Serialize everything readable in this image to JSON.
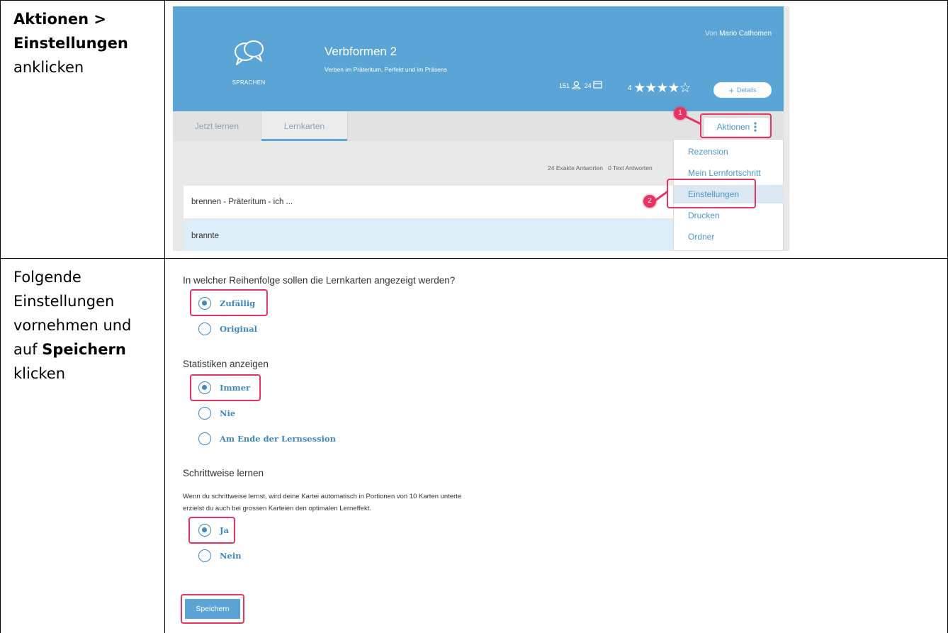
{
  "steps": [
    {
      "instruction": {
        "line1_bold": "Aktionen >",
        "line2_bold": "Einstellungen",
        "line3": "anklicken"
      }
    },
    {
      "instruction": {
        "line1": "Folgende",
        "line2": "Einstellungen",
        "line3": "vornehmen und",
        "line4_prefix": "auf ",
        "line4_bold": "Speichern",
        "line5": "klicken"
      }
    }
  ],
  "card_header": {
    "author_prefix": "Von",
    "author_name": "Mario Cathomen",
    "category": "SPRACHEN",
    "title": "Verbformen 2",
    "description": "Verben im Präteritum, Perfekt und im Präsens",
    "learners_count": "151",
    "cards_count": "24",
    "rating_count": "4",
    "stars": "★★★★☆",
    "details_label": "Details",
    "colors": {
      "header_bg": "#5ba5d6",
      "accent": "#4c95c9",
      "highlight": "#e53462"
    }
  },
  "tabs": [
    {
      "label": "Jetzt lernen"
    },
    {
      "label": "Lernkarten"
    }
  ],
  "actions_button": {
    "label": "Aktionen"
  },
  "answer_counts": {
    "exact": "24 Exakte Antworten",
    "text": "0 Text Antworten"
  },
  "card_rows": {
    "question": "brennen - Präteritum - ich ...",
    "answer": "brannte"
  },
  "actions_menu": [
    {
      "label": "Rezension"
    },
    {
      "label": "Mein Lernfortschritt"
    },
    {
      "label": "Einstellungen"
    },
    {
      "label": "Drucken"
    },
    {
      "label": "Ordner"
    }
  ],
  "callouts": [
    "1",
    "2"
  ],
  "settings": {
    "order": {
      "question": "In welcher Reihenfolge sollen die Lernkarten angezeigt werden?",
      "options": [
        "Zufällig",
        "Original"
      ],
      "selected": "Zufällig"
    },
    "statistics": {
      "question": "Statistiken anzeigen",
      "options": [
        "Immer",
        "Nie",
        "Am Ende der Lernsession"
      ],
      "selected": "Immer"
    },
    "stepwise": {
      "question": "Schrittweise lernen",
      "description_line1": "Wenn du schrittweise lernst, wird deine Kartei automatisch in Portionen von 10 Karten unterte",
      "description_line2": "erzielst du auch bei grossen Karteien den optimalen Lerneffekt.",
      "options": [
        "Ja",
        "Nein"
      ],
      "selected": "Ja"
    },
    "save_label": "Speichern"
  }
}
